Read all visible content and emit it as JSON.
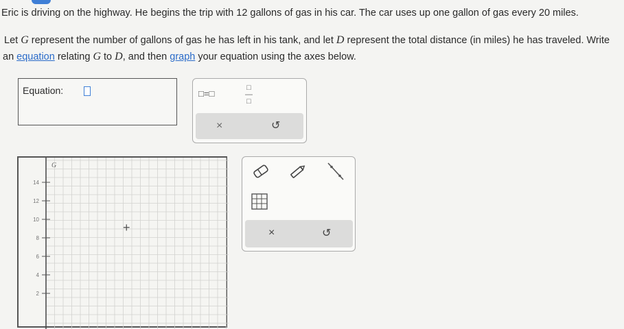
{
  "problem": {
    "line1": "Eric is driving on the highway. He begins the trip with 12 gallons of gas in his car. The car uses up one gallon of gas every 20 miles.",
    "line2a": "Let ",
    "var_g": "G",
    "line2b": " represent the number of gallons of gas he has left in his tank, and let ",
    "var_d": "D",
    "line2c": " represent the total distance (in miles) he has traveled. Write",
    "line3a": "an ",
    "link_equation": "equation",
    "line3b": " relating ",
    "line3c": " to ",
    "line3d": ", and then ",
    "link_graph": "graph",
    "line3e": " your equation using the axes below."
  },
  "equation": {
    "label": "Equation:"
  },
  "eq_palette": {
    "equals_template": "□=□",
    "fraction_template": "□ □",
    "clear_symbol": "×",
    "undo_symbol": "↺"
  },
  "graph": {
    "y_axis_label": "G",
    "y_ticks": [
      "14",
      "12",
      "10",
      "8",
      "6",
      "4",
      "2"
    ],
    "cursor_symbol": "+"
  },
  "tools": {
    "eraser_icon": "eraser-icon",
    "pencil_icon": "pencil-icon",
    "line_icon": "line-icon",
    "table_icon": "table-icon",
    "clear_symbol": "×",
    "undo_symbol": "↺"
  },
  "colors": {
    "accent": "#3f7fd6",
    "link": "#2a6bc9"
  }
}
